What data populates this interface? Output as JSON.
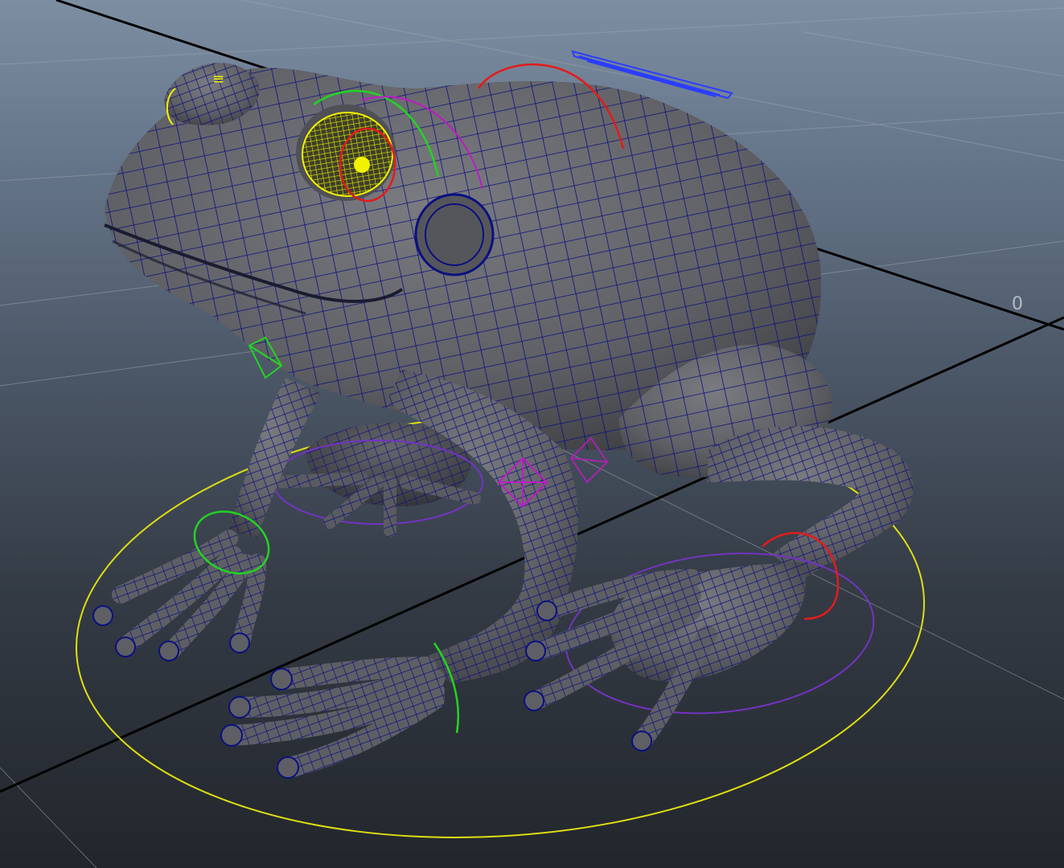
{
  "viewport": {
    "origin_label": "0",
    "colors": {
      "background_top": "#7e8ea2",
      "background_bottom": "#22262c",
      "grid": "#9aa3ad",
      "axis": "#000000",
      "mesh_fill": "#5e5f64",
      "wireframe": "#0b1080",
      "selection": "#f2f200",
      "ctrl_red": "#e31b1b",
      "ctrl_green": "#23d322",
      "ctrl_magenta": "#c01ac6",
      "ctrl_purple": "#7433c2",
      "ctrl_blue": "#2a3dff",
      "ctrl_yellow": "#dede12"
    }
  },
  "scene": {
    "model": "frog-mesh",
    "selected": "frog-eye",
    "controls": [
      "root-control-circle",
      "head-control",
      "eye-control",
      "body-control",
      "shoulder-control",
      "front-left-wrist-control",
      "front-right-wrist-control",
      "back-right-ankle-control",
      "back-foot-control",
      "front-right-hand-control",
      "knee-pole-control",
      "elbow-pole-control",
      "blue-label-control"
    ]
  }
}
